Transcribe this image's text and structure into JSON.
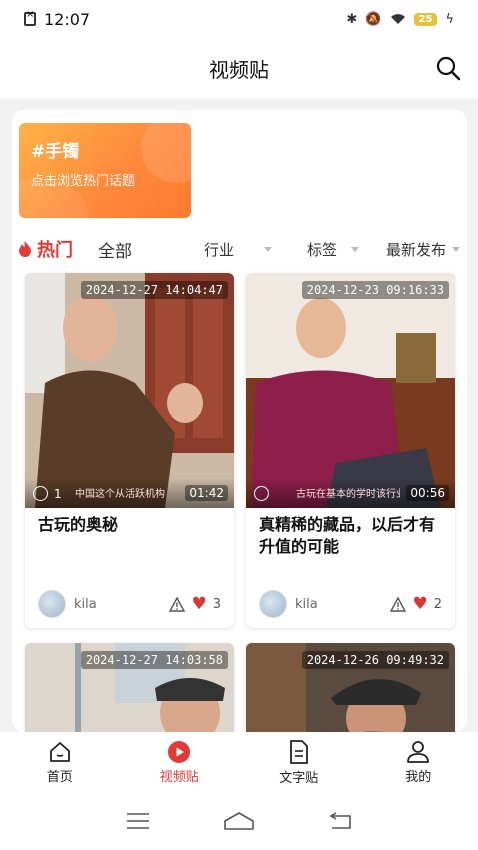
{
  "status": {
    "time": "12:07",
    "battery": "25"
  },
  "header": {
    "title": "视频贴"
  },
  "topic": {
    "title": "#手镯",
    "subtitle": "点击浏览热门话题"
  },
  "filters": {
    "hot": "热门",
    "all": "全部",
    "industry": "行业",
    "tags": "标签",
    "latest": "最新发布"
  },
  "cards": [
    {
      "timestamp": "2024-12-27 14:04:47",
      "comments": "1",
      "duration": "01:42",
      "caption": "中国这个从活跃机构",
      "title": "古玩的奥秘",
      "author": "kila",
      "likes": "3"
    },
    {
      "timestamp": "2024-12-23 09:16:33",
      "comments": "",
      "duration": "00:56",
      "caption": "古玩在基本的学时该行业",
      "title": "真精稀的藏品，以后才有升值的可能",
      "author": "kila",
      "likes": "2"
    },
    {
      "timestamp": "2024-12-27 14:03:58"
    },
    {
      "timestamp": "2024-12-26 09:49:32"
    }
  ],
  "nav": {
    "home": "首页",
    "video": "视频贴",
    "text": "文字贴",
    "mine": "我的"
  },
  "colors": {
    "accent": "#e53935",
    "topic_gradient_start": "#ffb347",
    "topic_gradient_end": "#ff7a2e"
  }
}
